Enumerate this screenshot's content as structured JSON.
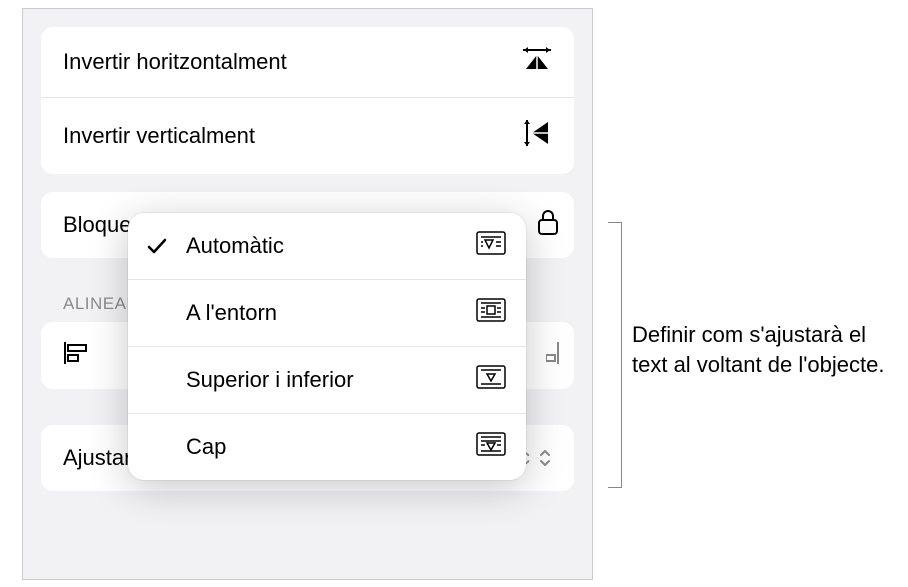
{
  "flip": {
    "horizontal": "Invertir horitzontalment",
    "vertical": "Invertir verticalment"
  },
  "lock": {
    "label_truncated": "Bloque"
  },
  "align": {
    "header": "ALINEAR"
  },
  "wrap": {
    "label": "Ajustar text",
    "value": "Automàtic"
  },
  "menu": {
    "items": [
      {
        "label": "Automàtic",
        "checked": true
      },
      {
        "label": "A l'entorn",
        "checked": false
      },
      {
        "label": "Superior i inferior",
        "checked": false
      },
      {
        "label": "Cap",
        "checked": false
      }
    ]
  },
  "callout": {
    "text": "Definir com s'ajustarà el text al voltant de l'objecte."
  }
}
